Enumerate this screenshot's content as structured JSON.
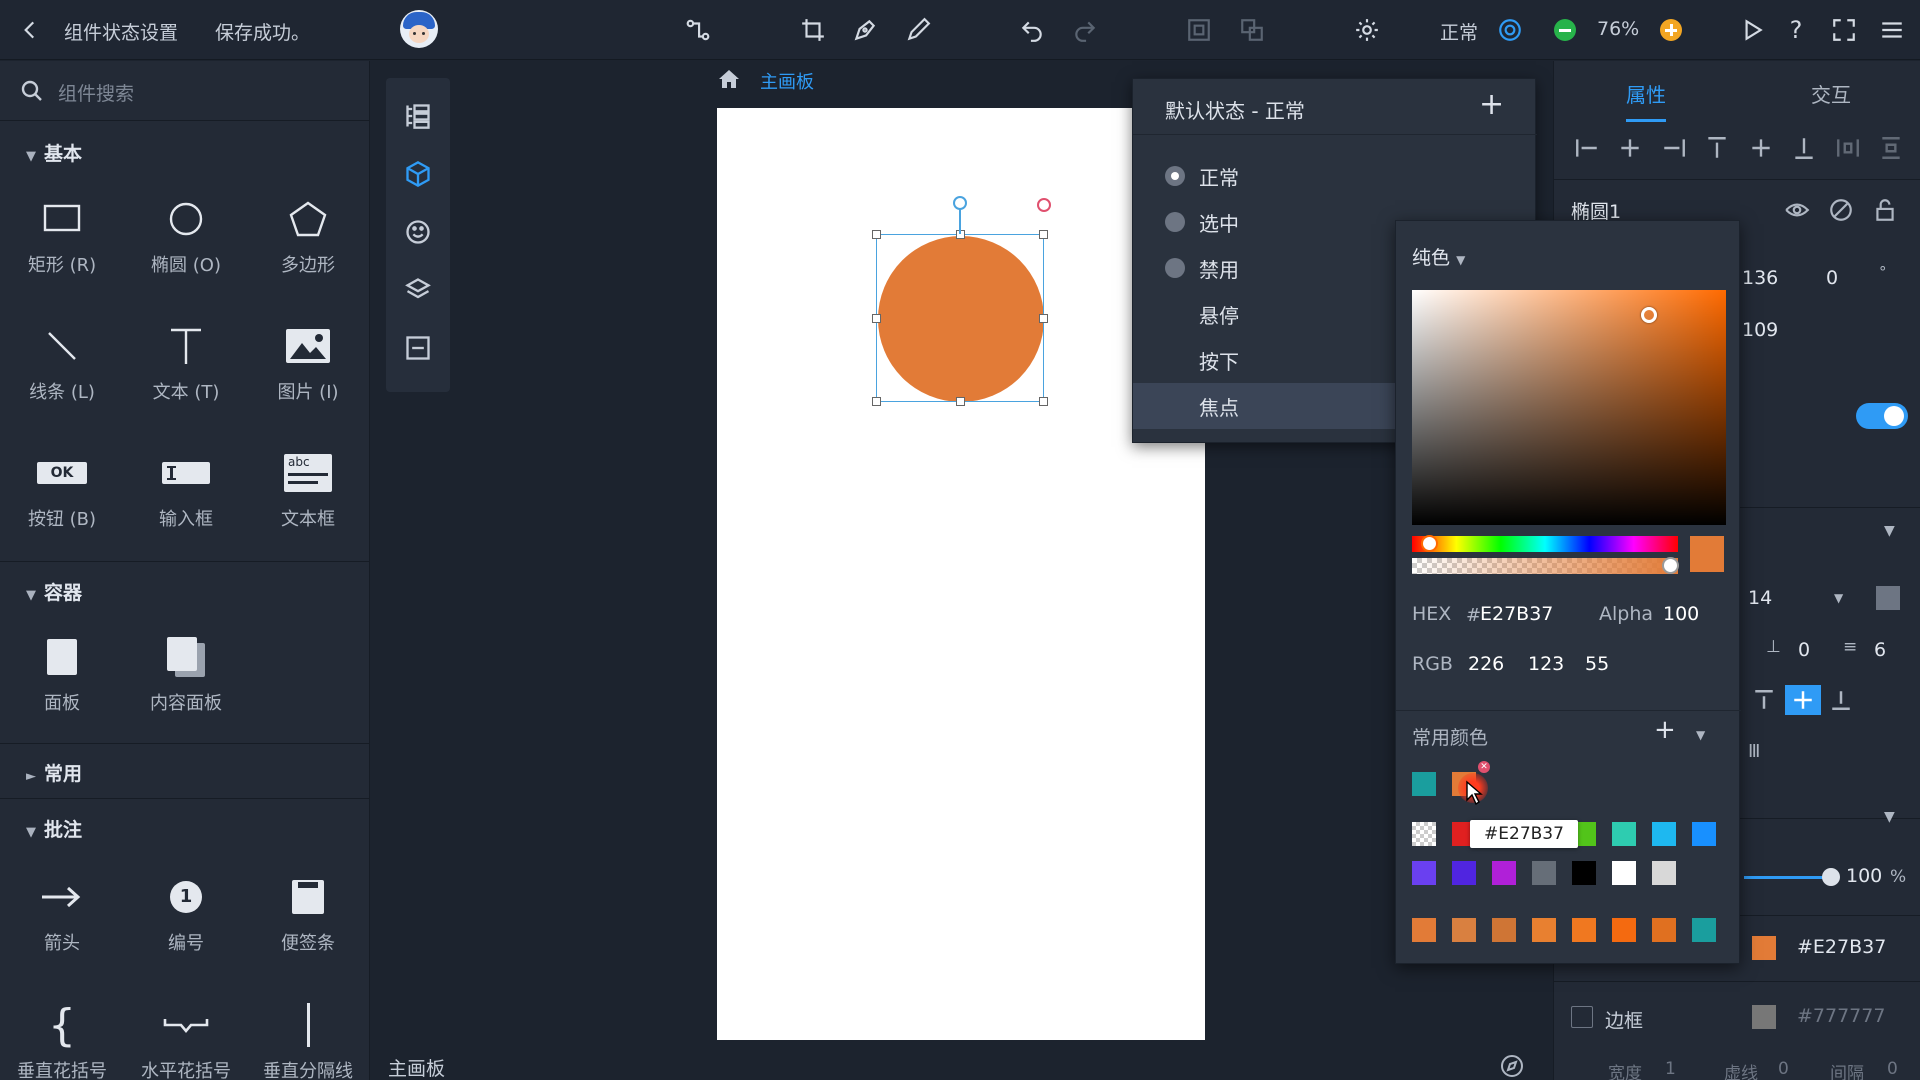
{
  "topbar": {
    "title": "组件状态设置",
    "save_status": "保存成功。",
    "mode": "正常",
    "zoom": "76%"
  },
  "left": {
    "search_placeholder": "组件搜索",
    "sections": {
      "basic": "基本",
      "container": "容器",
      "common": "常用",
      "annotation": "批注"
    },
    "basic_items": [
      "矩形 (R)",
      "椭圆 (O)",
      "多边形",
      "线条 (L)",
      "文本 (T)",
      "图片 (I)",
      "按钮 (B)",
      "输入框",
      "文本框"
    ],
    "button_icon_text": "OK",
    "textbox_icon_text": "abc",
    "container_items": [
      "面板",
      "内容面板"
    ],
    "annotation_items": [
      "箭头",
      "编号",
      "便签条",
      "垂直花括号",
      "水平花括号",
      "垂直分隔线"
    ],
    "number_badge": "1"
  },
  "canvas": {
    "breadcrumb": "主画板",
    "footer_label": "主画板"
  },
  "states": {
    "header": "默认状态 - 正常",
    "items": [
      "正常",
      "选中",
      "禁用",
      "悬停",
      "按下",
      "焦点"
    ]
  },
  "picker": {
    "mode": "纯色",
    "hex_label": "HEX",
    "hex_prefix": "#",
    "hex_value": "E27B37",
    "alpha_label": "Alpha",
    "alpha_value": "100",
    "rgb_label": "RGB",
    "r": "226",
    "g": "123",
    "b": "55",
    "common_colors_label": "常用颜色",
    "tooltip": "#E27B37",
    "current_color": "#E27B37",
    "hue_color": "#FF6A00",
    "recent_swatches": [
      "#1A9E9E",
      "#E27B37"
    ],
    "palette_row1": [
      "transparent",
      "#E02020",
      "#E27B37",
      "#F0C020",
      "#52C41A",
      "#2ECCB0",
      "#1EB8F0",
      "#1890FF"
    ],
    "palette_row2": [
      "#6A40F0",
      "#5025E0",
      "#B020D8",
      "#666E78",
      "#000000",
      "#FFFFFF",
      "#D8D8D8"
    ],
    "palette_row3": [
      "#E27B37",
      "#D98040",
      "#CF7535",
      "#E88030",
      "#F07820",
      "#F46A10",
      "#E07020",
      "#1A9E9E"
    ]
  },
  "right": {
    "tab_props": "属性",
    "tab_interact": "交互",
    "element_name": "椭圆1",
    "x": "136",
    "rotation": "0",
    "rotation_unit": "°",
    "y": "109",
    "font_size": "14",
    "spacing_a": "0",
    "spacing_b": "6",
    "opacity": "100",
    "opacity_unit": "%",
    "fill_hex": "#E27B37",
    "border_label": "边框",
    "border_hex": "#777777",
    "bottom_labels": [
      "宽度",
      "1",
      "虚线",
      "0",
      "间隔",
      "0"
    ]
  }
}
